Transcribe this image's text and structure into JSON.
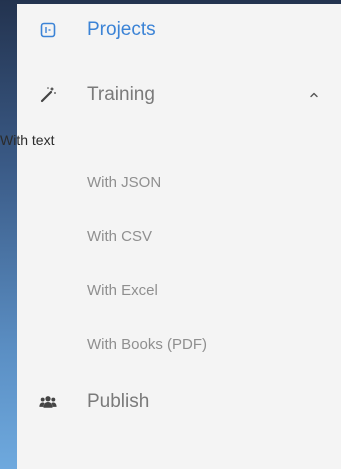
{
  "sidebar": {
    "items": [
      {
        "label": "Projects",
        "icon": "projects-icon",
        "active": true
      },
      {
        "label": "Training",
        "icon": "magic-wand-icon",
        "expanded": true
      },
      {
        "label": "Publish",
        "icon": "users-icon"
      }
    ],
    "training_group": {
      "heading": "With text",
      "subitems": [
        {
          "label": "With JSON"
        },
        {
          "label": "With CSV"
        },
        {
          "label": "With Excel"
        },
        {
          "label": "With Books (PDF)"
        }
      ]
    }
  },
  "colors": {
    "accent": "#3b83d6",
    "panel_background": "#f4f4f4",
    "muted_text": "#7a7a7a"
  }
}
